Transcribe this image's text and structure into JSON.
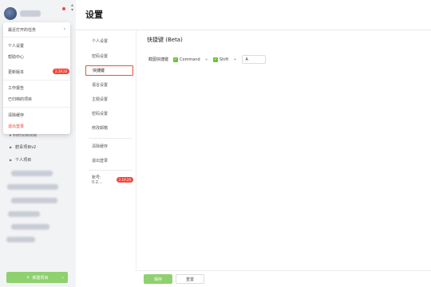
{
  "page_title": "设置",
  "sidebar": {
    "menu": {
      "recent_tasks": "最近打开的任务",
      "profile": "个人设置",
      "help": "帮助中心",
      "changelog": "更新版本",
      "changelog_badge": "2.19.20",
      "work_report": "工作报告",
      "archived": "已归档的项目",
      "clear_cache": "清除缓存",
      "logout": "退出登录"
    },
    "projects": {
      "partial_label": "▸ 科研项目简易",
      "team_project": "鹤青项目v2",
      "personal_project": "个人项目"
    },
    "new_project_label": "新建项目"
  },
  "settings_nav": {
    "items": [
      "个人设置",
      "密码设置",
      "快捷键",
      "语言设置",
      "主题设置",
      "密码设置",
      "修改邮箱"
    ],
    "clear_cache": "清除缓存",
    "logout": "退出登录",
    "account_prefix": "账号: 0.2…",
    "account_badge": "2.19.20"
  },
  "shortcut": {
    "section_title": "快捷键 (Beta)",
    "label": "截图快捷键",
    "key1": "Command",
    "key2": "Shift",
    "key3_value": "A"
  },
  "footer": {
    "save": "保存",
    "reset": "重置"
  },
  "colors": {
    "accent_green": "#8fd06f",
    "badge_red": "#f5473a",
    "active_border": "#e25340"
  }
}
